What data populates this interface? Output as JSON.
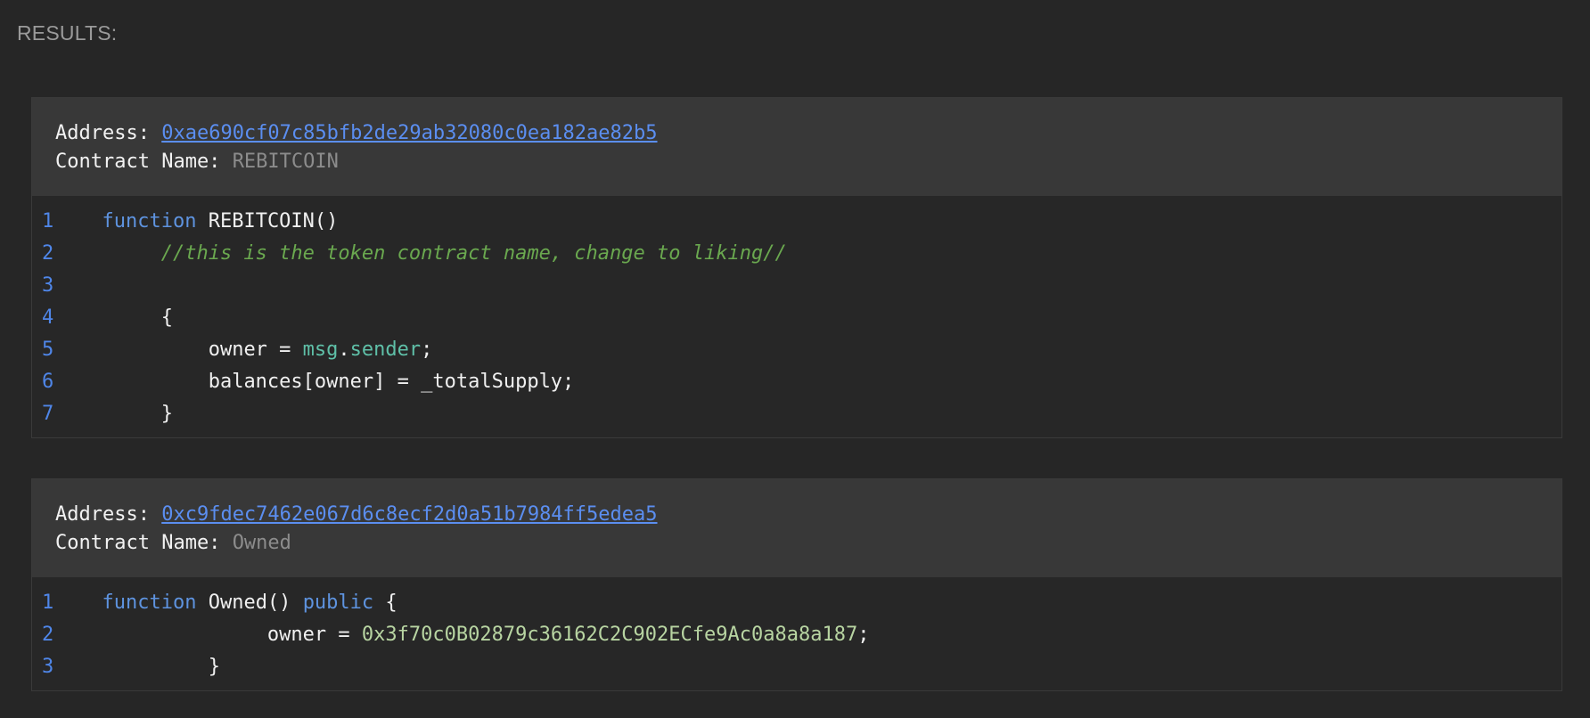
{
  "heading": "RESULTS:",
  "labels": {
    "address": "Address: ",
    "contract_name": "Contract Name: "
  },
  "results": [
    {
      "address": "0xae690cf07c85bfb2de29ab32080c0ea182ae82b5",
      "contract_name": "REBITCOIN",
      "lines": [
        {
          "no": "1",
          "indent": "  ",
          "parts": [
            {
              "t": "function",
              "c": "kw"
            },
            {
              "t": " REBITCOIN()",
              "c": ""
            }
          ]
        },
        {
          "no": "2",
          "indent": "       ",
          "parts": [
            {
              "t": "//this is the token contract name, change to liking//",
              "c": "cm"
            }
          ]
        },
        {
          "no": "3",
          "indent": "",
          "parts": []
        },
        {
          "no": "4",
          "indent": "       ",
          "parts": [
            {
              "t": "{",
              "c": ""
            }
          ]
        },
        {
          "no": "5",
          "indent": "           ",
          "parts": [
            {
              "t": "owner = ",
              "c": ""
            },
            {
              "t": "msg",
              "c": "obj"
            },
            {
              "t": ".",
              "c": ""
            },
            {
              "t": "sender",
              "c": "obj"
            },
            {
              "t": ";",
              "c": ""
            }
          ]
        },
        {
          "no": "6",
          "indent": "           ",
          "parts": [
            {
              "t": "balances[owner] = _totalSupply;",
              "c": ""
            }
          ]
        },
        {
          "no": "7",
          "indent": "       ",
          "parts": [
            {
              "t": "}",
              "c": ""
            }
          ]
        }
      ]
    },
    {
      "address": "0xc9fdec7462e067d6c8ecf2d0a51b7984ff5edea5",
      "contract_name": "Owned",
      "lines": [
        {
          "no": "1",
          "indent": "  ",
          "parts": [
            {
              "t": "function",
              "c": "kw"
            },
            {
              "t": " Owned() ",
              "c": ""
            },
            {
              "t": "public",
              "c": "kw"
            },
            {
              "t": " {",
              "c": ""
            }
          ]
        },
        {
          "no": "2",
          "indent": "                ",
          "parts": [
            {
              "t": "owner = ",
              "c": ""
            },
            {
              "t": "0x3f70c0B02879c36162C2C902ECfe9Ac0a8a8a187",
              "c": "num"
            },
            {
              "t": ";",
              "c": ""
            }
          ]
        },
        {
          "no": "3",
          "indent": "           ",
          "parts": [
            {
              "t": "}",
              "c": ""
            }
          ]
        }
      ]
    }
  ]
}
